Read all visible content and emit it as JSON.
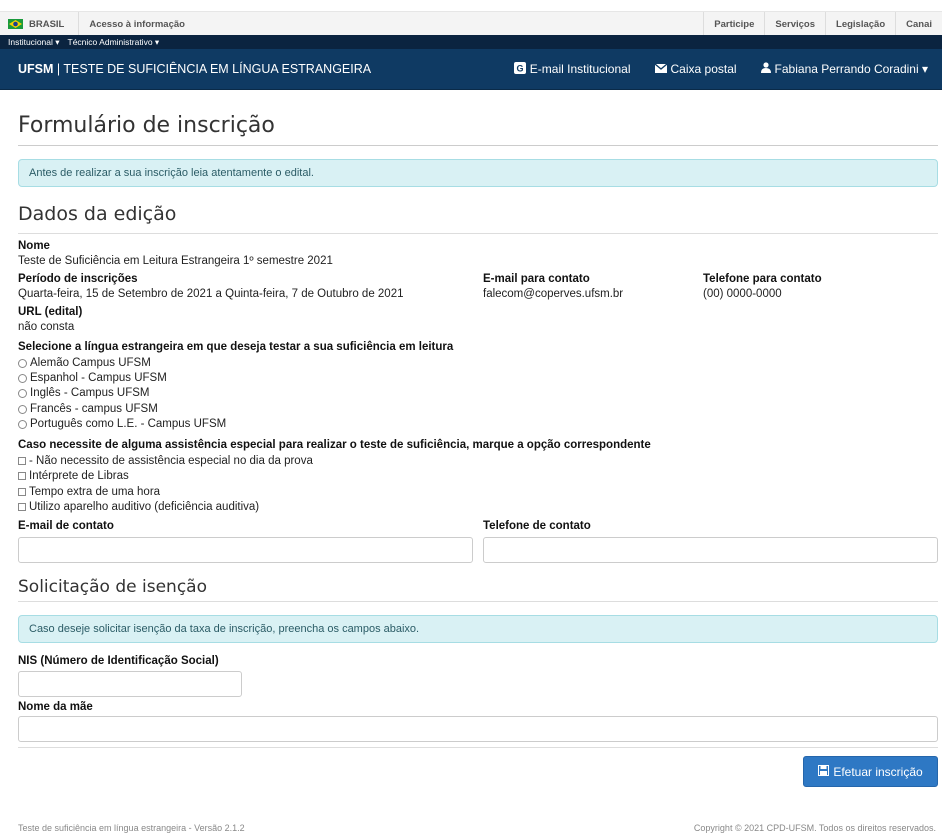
{
  "govbar": {
    "country": "BRASIL",
    "access": "Acesso à informação",
    "links": [
      "Participe",
      "Serviços",
      "Legislação",
      "Canai"
    ]
  },
  "instbar": {
    "item1": "Institucional ▾",
    "item2": "Técnico Administrativo ▾"
  },
  "navbar": {
    "brand_bold": "UFSM",
    "brand_rest": " | TESTE DE SUFICIÊNCIA EM LÍNGUA ESTRANGEIRA",
    "email": "E-mail Institucional",
    "inbox": "Caixa postal",
    "user": "Fabiana Perrando Coradini ▾"
  },
  "page": {
    "title": "Formulário de inscrição",
    "notice": "Antes de realizar a sua inscrição leia atentamente o edital."
  },
  "edition": {
    "heading": "Dados da edição",
    "name_label": "Nome",
    "name_value": "Teste de Suficiência em Leitura Estrangeira 1º semestre 2021",
    "period_label": "Período de inscrições",
    "period_value": "Quarta-feira, 15 de Setembro de 2021 a Quinta-feira, 7 de Outubro de 2021",
    "email_label": "E-mail para contato",
    "email_value": "falecom@coperves.ufsm.br",
    "phone_label": "Telefone para contato",
    "phone_value": "(00) 0000-0000",
    "url_label": "URL (edital)",
    "url_value": "não consta"
  },
  "language": {
    "label": "Selecione a língua estrangeira em que deseja testar a sua suficiência em leitura",
    "options": [
      "Alemão Campus UFSM",
      "Espanhol - Campus UFSM",
      "Inglês - Campus UFSM",
      "Francês - campus UFSM",
      "Português como L.E. - Campus UFSM"
    ]
  },
  "assistance": {
    "label": "Caso necessite de alguma assistência especial para realizar o teste de suficiência, marque a opção correspondente",
    "options": [
      "- Não necessito de assistência especial no dia da prova",
      "Intérprete de Libras",
      "Tempo extra de uma hora",
      "Utilizo aparelho auditivo (deficiência auditiva)"
    ]
  },
  "contact": {
    "email_label": "E-mail de contato",
    "email_value": "",
    "phone_label": "Telefone de contato",
    "phone_value": ""
  },
  "exemption": {
    "heading": "Solicitação de isenção",
    "notice": "Caso deseje solicitar isenção da taxa de inscrição, preencha os campos abaixo.",
    "nis_label": "NIS (Número de Identificação Social)",
    "nis_value": "",
    "mother_label": "Nome da mãe",
    "mother_value": ""
  },
  "submit": {
    "label": "Efetuar inscrição"
  },
  "footer": {
    "left": "Teste de suficiência em língua estrangeira - Versão 2.1.2",
    "right": "Copyright © 2021 CPD-UFSM. Todos os direitos reservados."
  }
}
